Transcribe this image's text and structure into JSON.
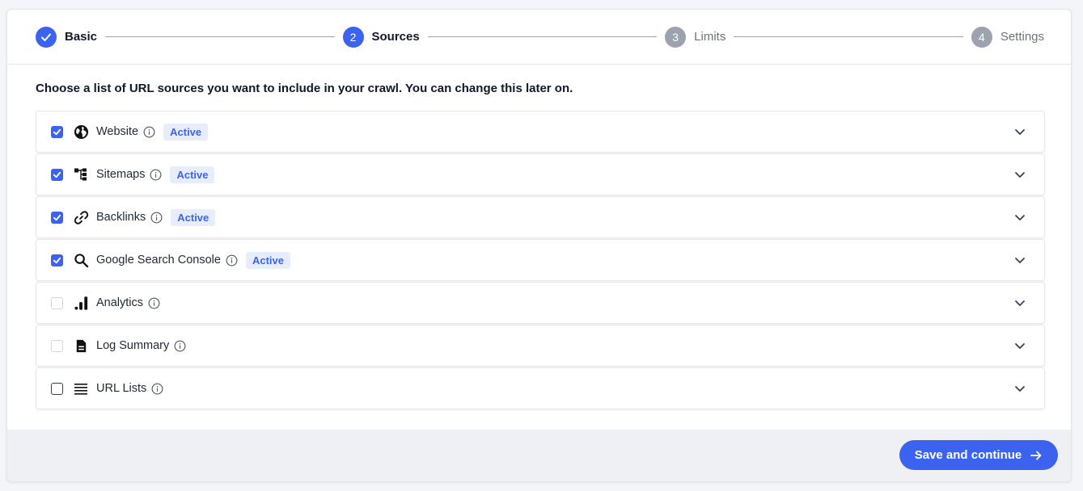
{
  "stepper": {
    "steps": [
      {
        "number": "",
        "label": "Basic",
        "state": "done"
      },
      {
        "number": "2",
        "label": "Sources",
        "state": "active"
      },
      {
        "number": "3",
        "label": "Limits",
        "state": "todo"
      },
      {
        "number": "4",
        "label": "Settings",
        "state": "todo"
      }
    ]
  },
  "intro": "Choose a list of URL sources you want to include in your crawl. You can change this later on.",
  "sources": [
    {
      "label": "Website",
      "icon": "globe-icon",
      "checked": true,
      "badge": "Active"
    },
    {
      "label": "Sitemaps",
      "icon": "sitemap-icon",
      "checked": true,
      "badge": "Active"
    },
    {
      "label": "Backlinks",
      "icon": "link-icon",
      "checked": true,
      "badge": "Active"
    },
    {
      "label": "Google Search Console",
      "icon": "search-icon",
      "checked": true,
      "badge": "Active"
    },
    {
      "label": "Analytics",
      "icon": "bar-chart-icon",
      "checked": false,
      "badge": ""
    },
    {
      "label": "Log Summary",
      "icon": "document-icon",
      "checked": false,
      "badge": ""
    },
    {
      "label": "URL Lists",
      "icon": "list-icon",
      "checked": false,
      "badge": ""
    }
  ],
  "footer": {
    "save_label": "Save and continue"
  },
  "colors": {
    "accent": "#3b63f0",
    "badge_bg": "#e7edfd",
    "inactive_step": "#9ca3af"
  }
}
